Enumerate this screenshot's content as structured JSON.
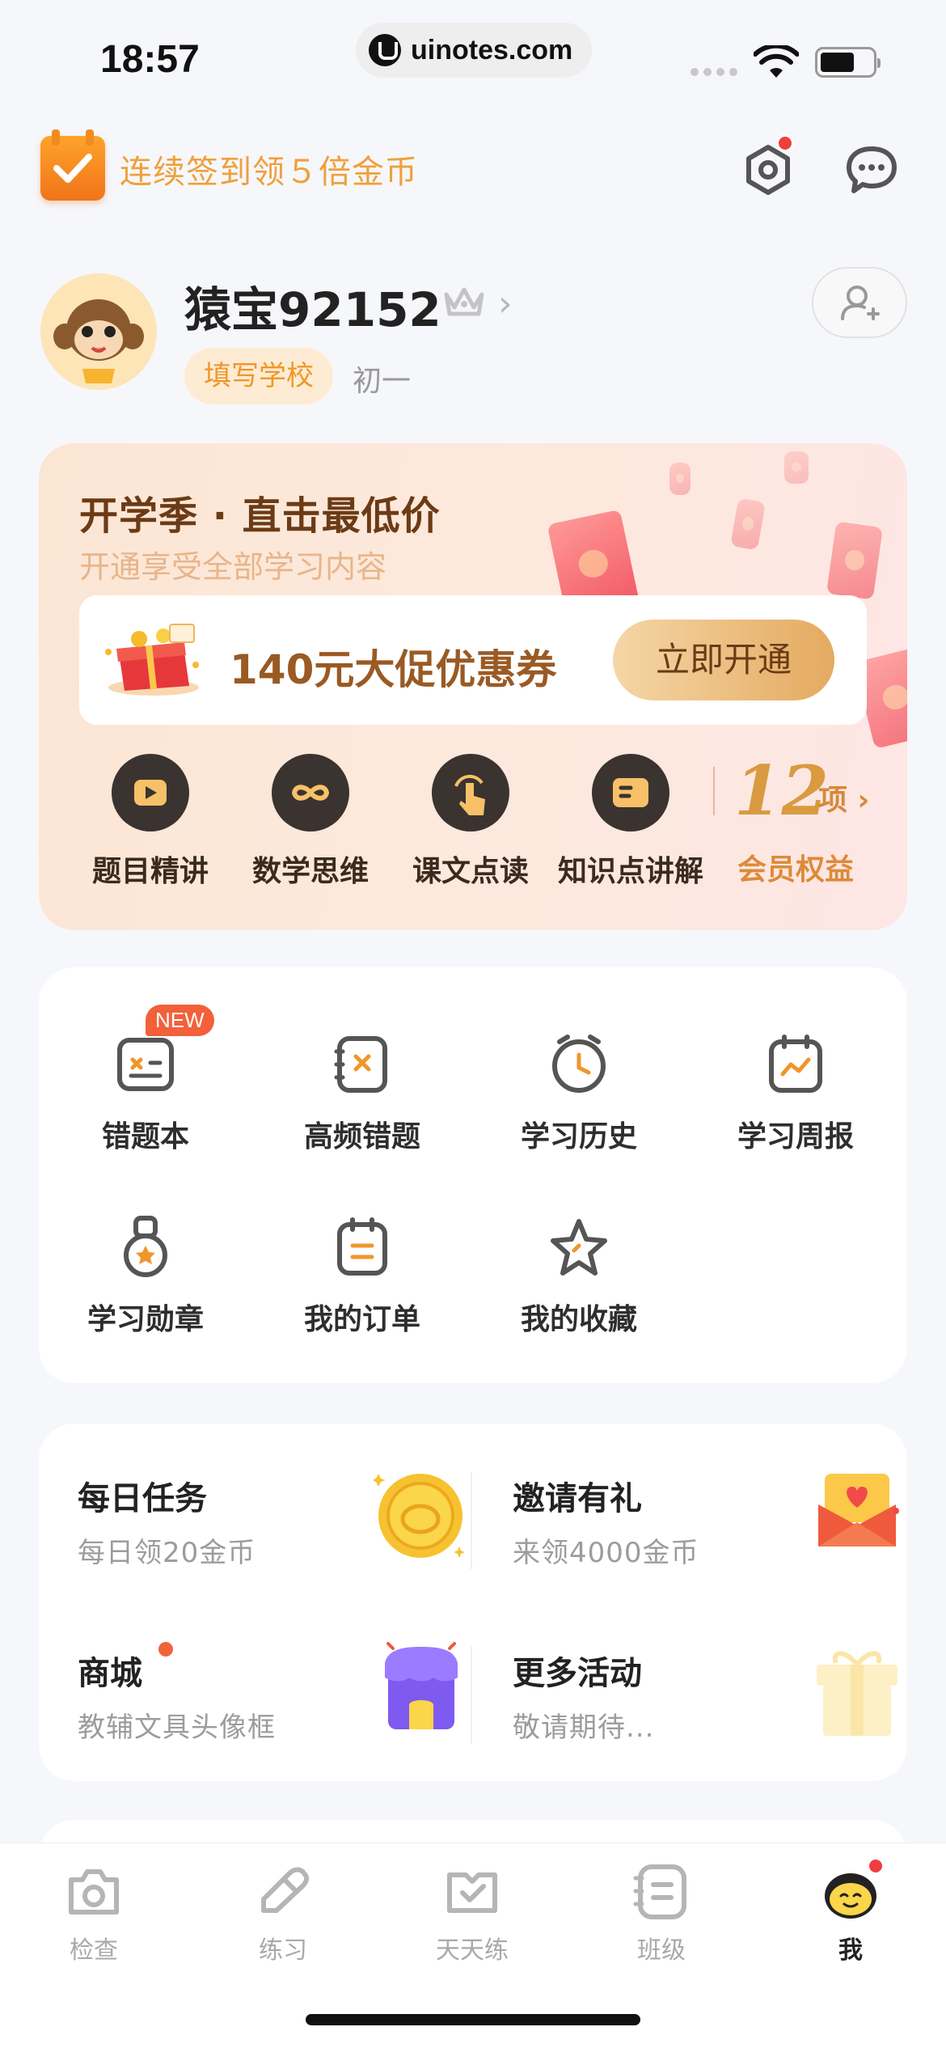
{
  "status_bar": {
    "time": "18:57",
    "url": "uinotes.com"
  },
  "header": {
    "signin_text": "连续签到领５倍金币"
  },
  "profile": {
    "username": "猿宝92152",
    "school_button": "填写学校",
    "grade": "初一"
  },
  "vip": {
    "title": "开学季 · 直击最低价",
    "subtitle": "开通享受全部学习内容",
    "coupon_text": "140元大促优惠券",
    "open_button": "立即开通",
    "features": [
      {
        "label": "题目精讲",
        "icon": "play-icon"
      },
      {
        "label": "数学思维",
        "icon": "infinity-icon"
      },
      {
        "label": "课文点读",
        "icon": "finger-tap-icon"
      },
      {
        "label": "知识点讲解",
        "icon": "card-icon"
      }
    ],
    "benefits_count": "12",
    "benefits_unit": "项",
    "benefits_label": "会员权益"
  },
  "tools": {
    "new_badge": "NEW",
    "items": [
      {
        "label": "错题本",
        "icon": "wrong-notebook-icon"
      },
      {
        "label": "高频错题",
        "icon": "frequent-mistake-icon"
      },
      {
        "label": "学习历史",
        "icon": "clock-icon"
      },
      {
        "label": "学习周报",
        "icon": "weekly-report-icon"
      },
      {
        "label": "学习勋章",
        "icon": "medal-icon"
      },
      {
        "label": "我的订单",
        "icon": "order-icon"
      },
      {
        "label": "我的收藏",
        "icon": "star-icon"
      }
    ]
  },
  "tasks": [
    {
      "title": "每日任务",
      "sub": "每日领20金币",
      "icon": "gold-coin-icon"
    },
    {
      "title": "邀请有礼",
      "sub": "来领4000金币",
      "icon": "red-envelope-icon"
    },
    {
      "title": "商城",
      "sub": "教辅文具头像框",
      "icon": "shop-icon"
    },
    {
      "title": "更多活动",
      "sub": "敬请期待...",
      "icon": "gift-box-icon"
    }
  ],
  "tabbar": {
    "items": [
      {
        "label": "检查",
        "icon": "camera-icon"
      },
      {
        "label": "练习",
        "icon": "pencil-icon"
      },
      {
        "label": "天天练",
        "icon": "daily-check-icon"
      },
      {
        "label": "班级",
        "icon": "class-icon"
      },
      {
        "label": "我",
        "icon": "me-mascot-icon"
      }
    ],
    "active": "我"
  },
  "colors": {
    "accent": "#f0962a",
    "vip_brown": "#6b3b16",
    "alert_red": "#f03d3d"
  }
}
